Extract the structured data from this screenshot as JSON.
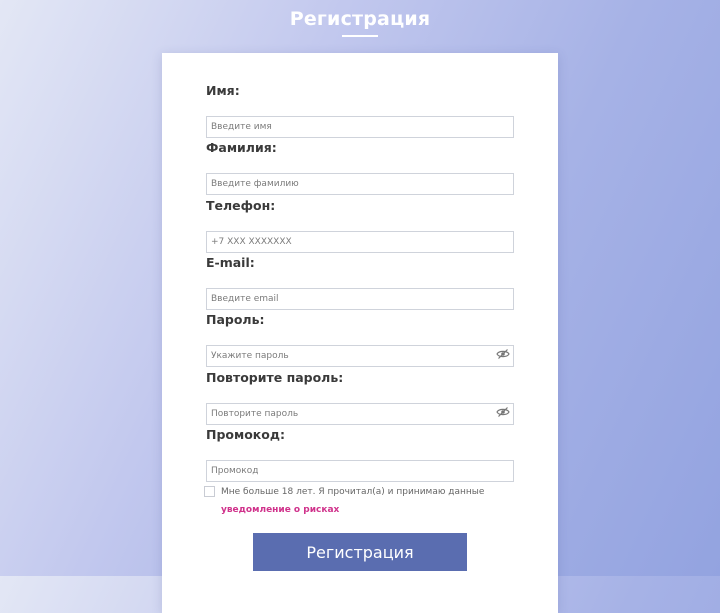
{
  "page": {
    "title": "Регистрация"
  },
  "form": {
    "fields": [
      {
        "label": "Имя:",
        "placeholder": "Введите имя",
        "value": ""
      },
      {
        "label": "Фамилия:",
        "placeholder": "Введите фамилию",
        "value": ""
      },
      {
        "label": "Телефон:",
        "placeholder": "+7 XXX XXXXXXX",
        "value": ""
      },
      {
        "label": "E-mail:",
        "placeholder": "Введите email",
        "value": ""
      },
      {
        "label": "Пароль:",
        "placeholder": "Укажите пароль",
        "value": "",
        "icon": "eye-slash-icon"
      },
      {
        "label": "Повторите пароль:",
        "placeholder": "Повторите пароль",
        "value": "",
        "icon": "eye-slash-icon"
      },
      {
        "label": "Промокод:",
        "placeholder": "Промокод",
        "value": ""
      }
    ],
    "consent": {
      "text": "Мне больше 18 лет. Я прочитал(а) и принимаю данные",
      "link": "уведомление о рисках",
      "checked": false
    },
    "submit_label": "Регистрация"
  },
  "colors": {
    "accent": "#5a6db0",
    "link": "#d0328b",
    "background_start": "#e3e7f5",
    "background_end": "#93a3e0"
  }
}
